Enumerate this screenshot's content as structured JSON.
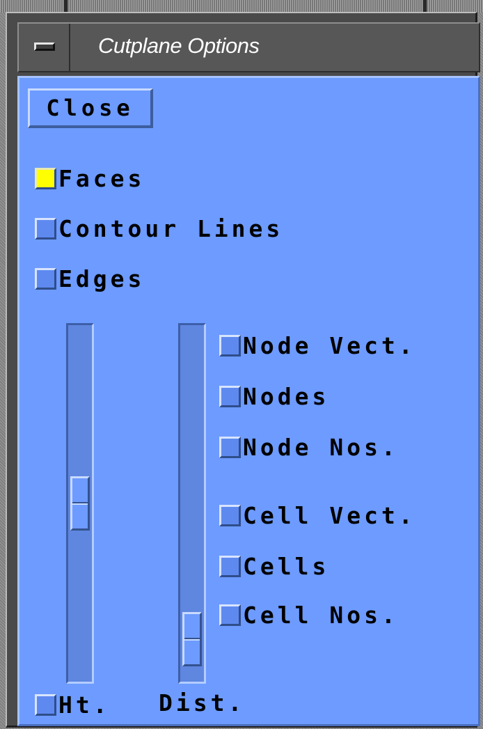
{
  "window": {
    "title": "Cutplane Options"
  },
  "buttons": {
    "close_label": "Close"
  },
  "display_options": [
    {
      "label": "Faces",
      "checked": true
    },
    {
      "label": "Contour Lines",
      "checked": false
    },
    {
      "label": "Edges",
      "checked": false
    }
  ],
  "node_options": [
    {
      "label": "Node Vect.",
      "checked": false
    },
    {
      "label": "Nodes",
      "checked": false
    },
    {
      "label": "Node Nos.",
      "checked": false
    }
  ],
  "cell_options": [
    {
      "label": "Cell Vect.",
      "checked": false
    },
    {
      "label": "Cells",
      "checked": false
    },
    {
      "label": "Cell Nos.",
      "checked": false
    }
  ],
  "sliders": {
    "height": {
      "label": "Ht.",
      "checked": false,
      "value_fraction": 0.5
    },
    "distance": {
      "label": "Dist.",
      "value_fraction": 0.95
    }
  },
  "colors": {
    "panel_bg": "#6d9bff",
    "checked_indicator": "#ffff00",
    "title_text": "#ffffff"
  },
  "icons": {
    "window_menu": "window-menu-icon"
  }
}
